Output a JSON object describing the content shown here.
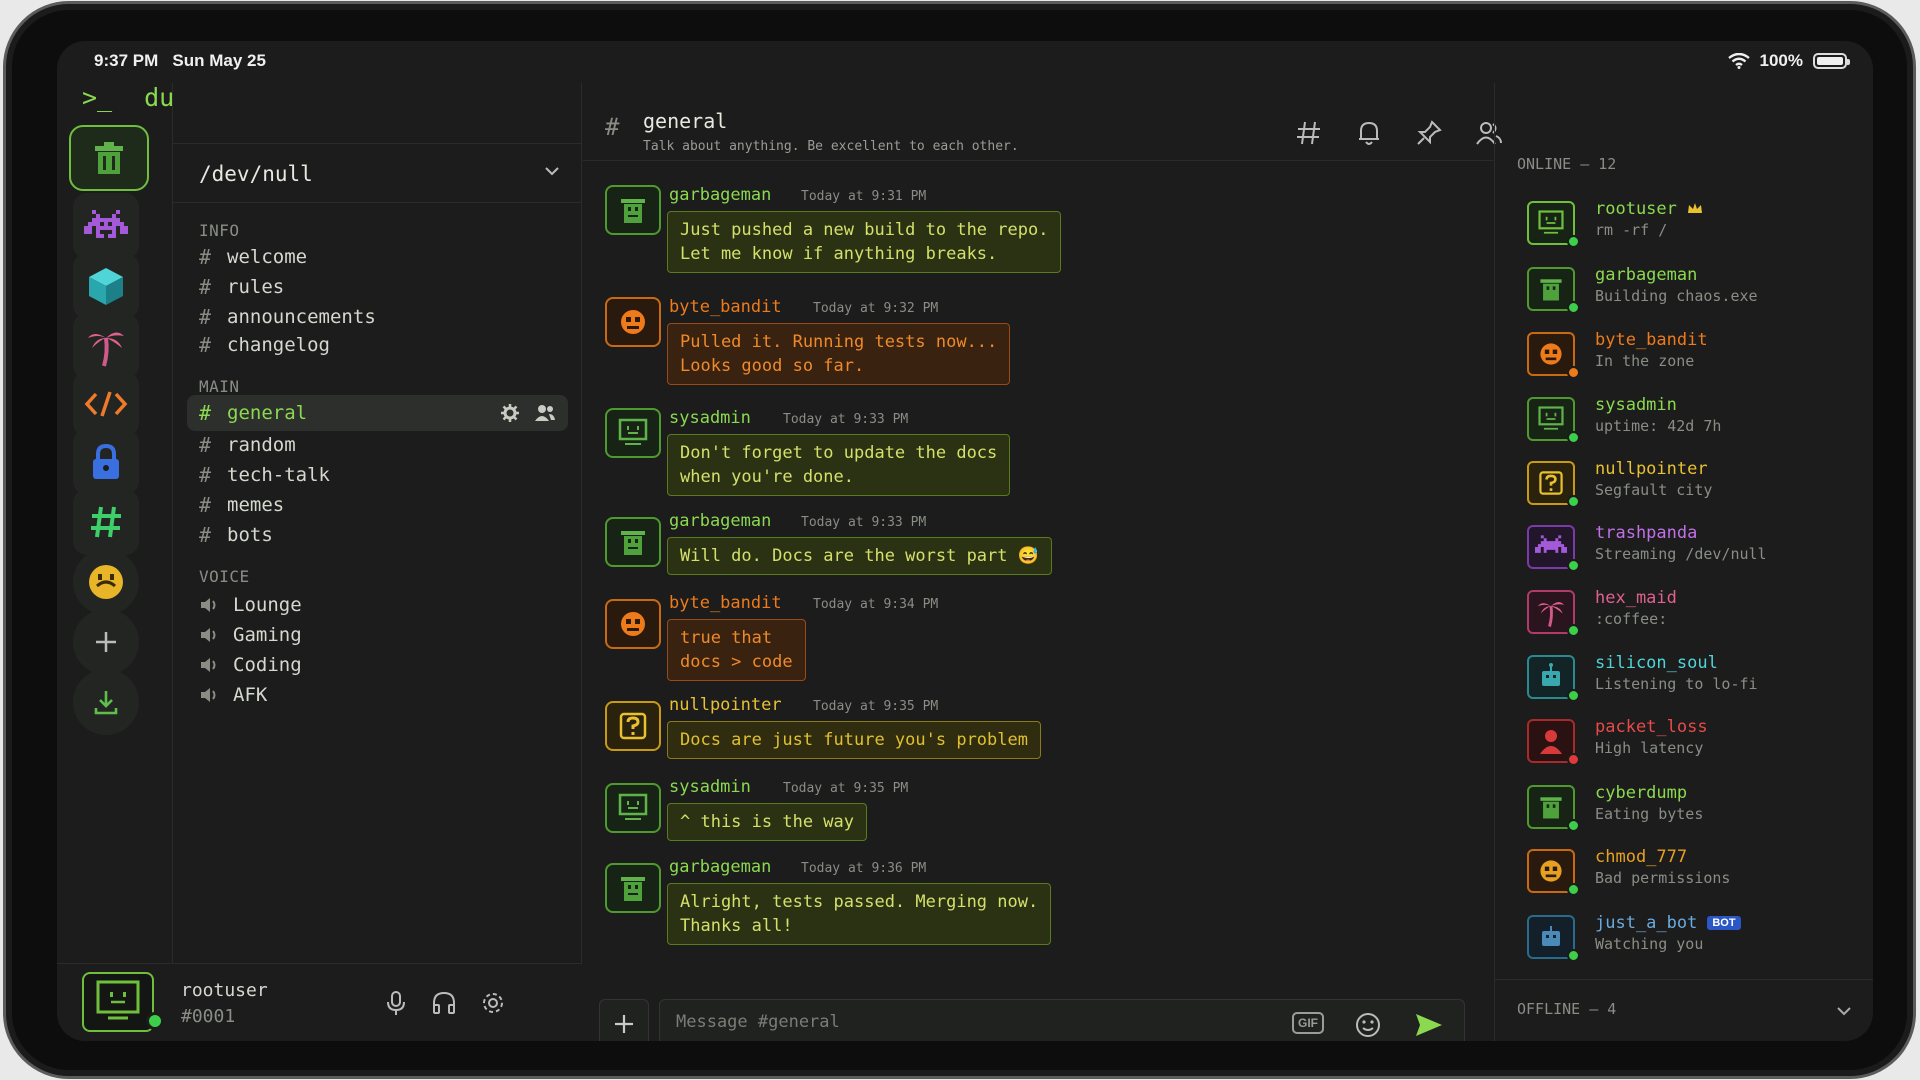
{
  "status": {
    "time": "9:37 PM",
    "date": "Sun May 25",
    "battery": "100%"
  },
  "brand": {
    "prompt": ">_",
    "name": "dumpsterChat"
  },
  "server": {
    "name": "/dev/null"
  },
  "categories": {
    "info": "INFO",
    "main": "MAIN",
    "voice": "VOICE"
  },
  "channels": {
    "info": [
      "welcome",
      "rules",
      "announcements",
      "changelog"
    ],
    "main": [
      "general",
      "random",
      "tech-talk",
      "memes",
      "bots"
    ],
    "voice": [
      "Lounge",
      "Gaming",
      "Coding",
      "AFK"
    ]
  },
  "user": {
    "name": "rootuser",
    "tag": "#0001"
  },
  "chat": {
    "hash": "#",
    "title": "general",
    "topic": "Talk about anything. Be excellent to each other."
  },
  "messages": [
    {
      "author": "garbageman",
      "time": "Today at 9:31 PM",
      "text": "Just pushed a new build to the repo.\nLet me know if anything breaks."
    },
    {
      "author": "byte_bandit",
      "time": "Today at 9:32 PM",
      "text": "Pulled it. Running tests now...\nLooks good so far."
    },
    {
      "author": "sysadmin",
      "time": "Today at 9:33 PM",
      "text": "Don't forget to update the docs\nwhen you're done."
    },
    {
      "author": "garbageman",
      "time": "Today at 9:33 PM",
      "text": "Will do. Docs are the worst part 😅"
    },
    {
      "author": "byte_bandit",
      "time": "Today at 9:34 PM",
      "text": "true that\ndocs > code"
    },
    {
      "author": "nullpointer",
      "time": "Today at 9:35 PM",
      "text": "Docs are just future you's problem"
    },
    {
      "author": "sysadmin",
      "time": "Today at 9:35 PM",
      "text": "^ this is the way"
    },
    {
      "author": "garbageman",
      "time": "Today at 9:36 PM",
      "text": "Alright, tests passed. Merging now.\nThanks all!"
    }
  ],
  "composer": {
    "placeholder": "Message #general",
    "gif": "GIF"
  },
  "members": {
    "online_header": "ONLINE — 12",
    "offline_header": "OFFLINE — 4",
    "list": [
      {
        "name": "rootuser",
        "status": "rm -rf /"
      },
      {
        "name": "garbageman",
        "status": "Building chaos.exe"
      },
      {
        "name": "byte_bandit",
        "status": "In the zone"
      },
      {
        "name": "sysadmin",
        "status": "uptime: 42d 7h"
      },
      {
        "name": "nullpointer",
        "status": "Segfault city"
      },
      {
        "name": "trashpanda",
        "status": "Streaming /dev/null"
      },
      {
        "name": "hex_maid",
        "status": ":coffee:"
      },
      {
        "name": "silicon_soul",
        "status": "Listening to lo-fi"
      },
      {
        "name": "packet_loss",
        "status": "High latency"
      },
      {
        "name": "cyberdump",
        "status": "Eating bytes"
      },
      {
        "name": "chmod_777",
        "status": "Bad permissions"
      },
      {
        "name": "just_a_bot",
        "status": "Watching you",
        "badge": "BOT"
      }
    ]
  },
  "colors": {
    "accent": "#8bd94f",
    "orange": "#ef7a1a",
    "yellow": "#e8c030",
    "background": "#1b1c1b"
  }
}
